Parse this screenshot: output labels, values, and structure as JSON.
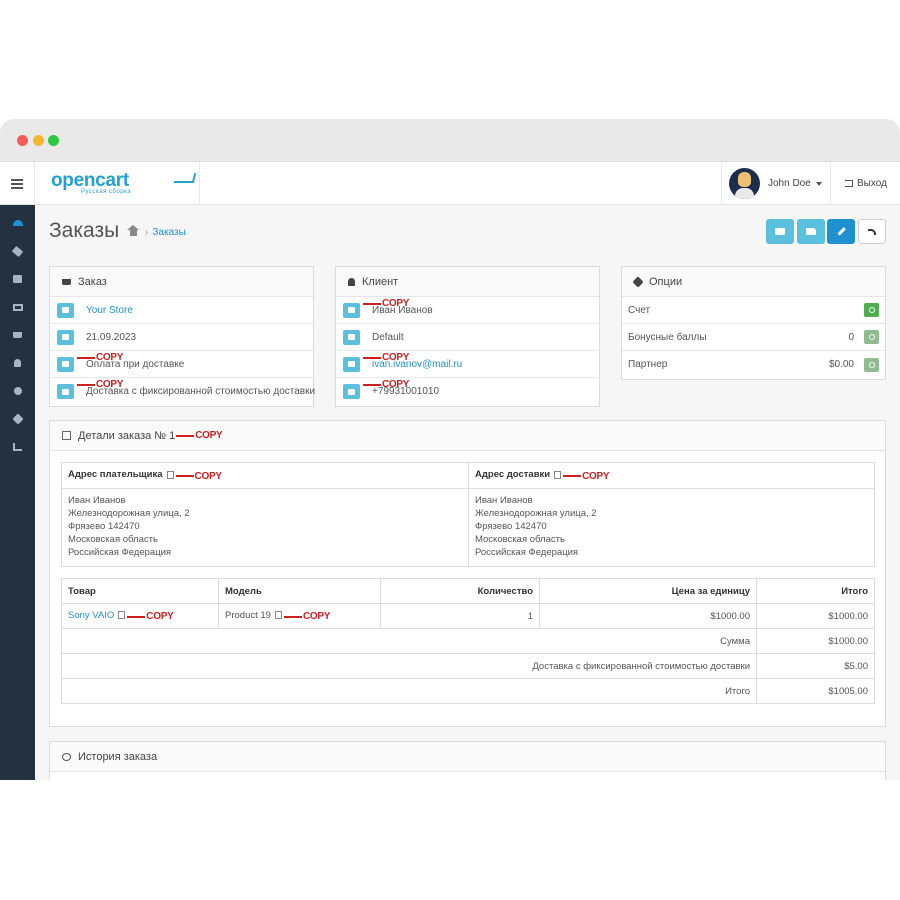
{
  "window": {},
  "header": {
    "logo_main": "opencart",
    "logo_sub": "Русская сборка",
    "user_name": "John Doe",
    "logout_label": "Выход"
  },
  "sidebar": {
    "items": [
      "dashboard-icon",
      "tag-icon",
      "puzzle-icon",
      "monitor-icon",
      "cart-icon",
      "user-icon",
      "share-icon",
      "gear-icon",
      "chart-icon"
    ]
  },
  "page": {
    "title": "Заказы",
    "breadcrumb_current": "Заказы"
  },
  "order_panel": {
    "title": "Заказ",
    "store": "Your Store",
    "date": "21.09.2023",
    "payment": "Оплата при доставке",
    "shipping": "Доставка с фиксированной стоимостью доставки"
  },
  "client_panel": {
    "title": "Клиент",
    "name": "Иван Иванов",
    "group": "Default",
    "email": "ivan.ivanov@mail.ru",
    "phone": "+79931001010"
  },
  "options_panel": {
    "title": "Опции",
    "invoice_label": "Счет",
    "bonus_label": "Бонусные баллы",
    "bonus_value": "0",
    "partner_label": "Партнер",
    "partner_value": "$0.00"
  },
  "copy_label": "COPY",
  "details": {
    "title": "Детали заказа № 1",
    "payment_address_header": "Адрес плательщика",
    "shipping_address_header": "Адрес доставки",
    "payment_address": [
      "Иван Иванов",
      "Железнодорожная улица, 2",
      "Фрязево 142470",
      "Московская область",
      "Российская Федерация"
    ],
    "shipping_address": [
      "Иван Иванов",
      "Железнодорожная улица, 2",
      "Фрязево 142470",
      "Московская область",
      "Российская Федерация"
    ],
    "columns": {
      "product": "Товар",
      "model": "Модель",
      "quantity": "Количество",
      "unit_price": "Цена за единицу",
      "total": "Итого"
    },
    "items": [
      {
        "product": "Sony VAIO",
        "model": "Product 19",
        "quantity": "1",
        "unit_price": "$1000.00",
        "total": "$1000.00"
      }
    ],
    "totals": [
      {
        "label": "Сумма",
        "value": "$1000.00"
      },
      {
        "label": "Доставка с фиксированной стоимостью доставки",
        "value": "$5.00"
      },
      {
        "label": "Итого",
        "value": "$1005.00"
      }
    ]
  },
  "history": {
    "title": "История заказа"
  }
}
